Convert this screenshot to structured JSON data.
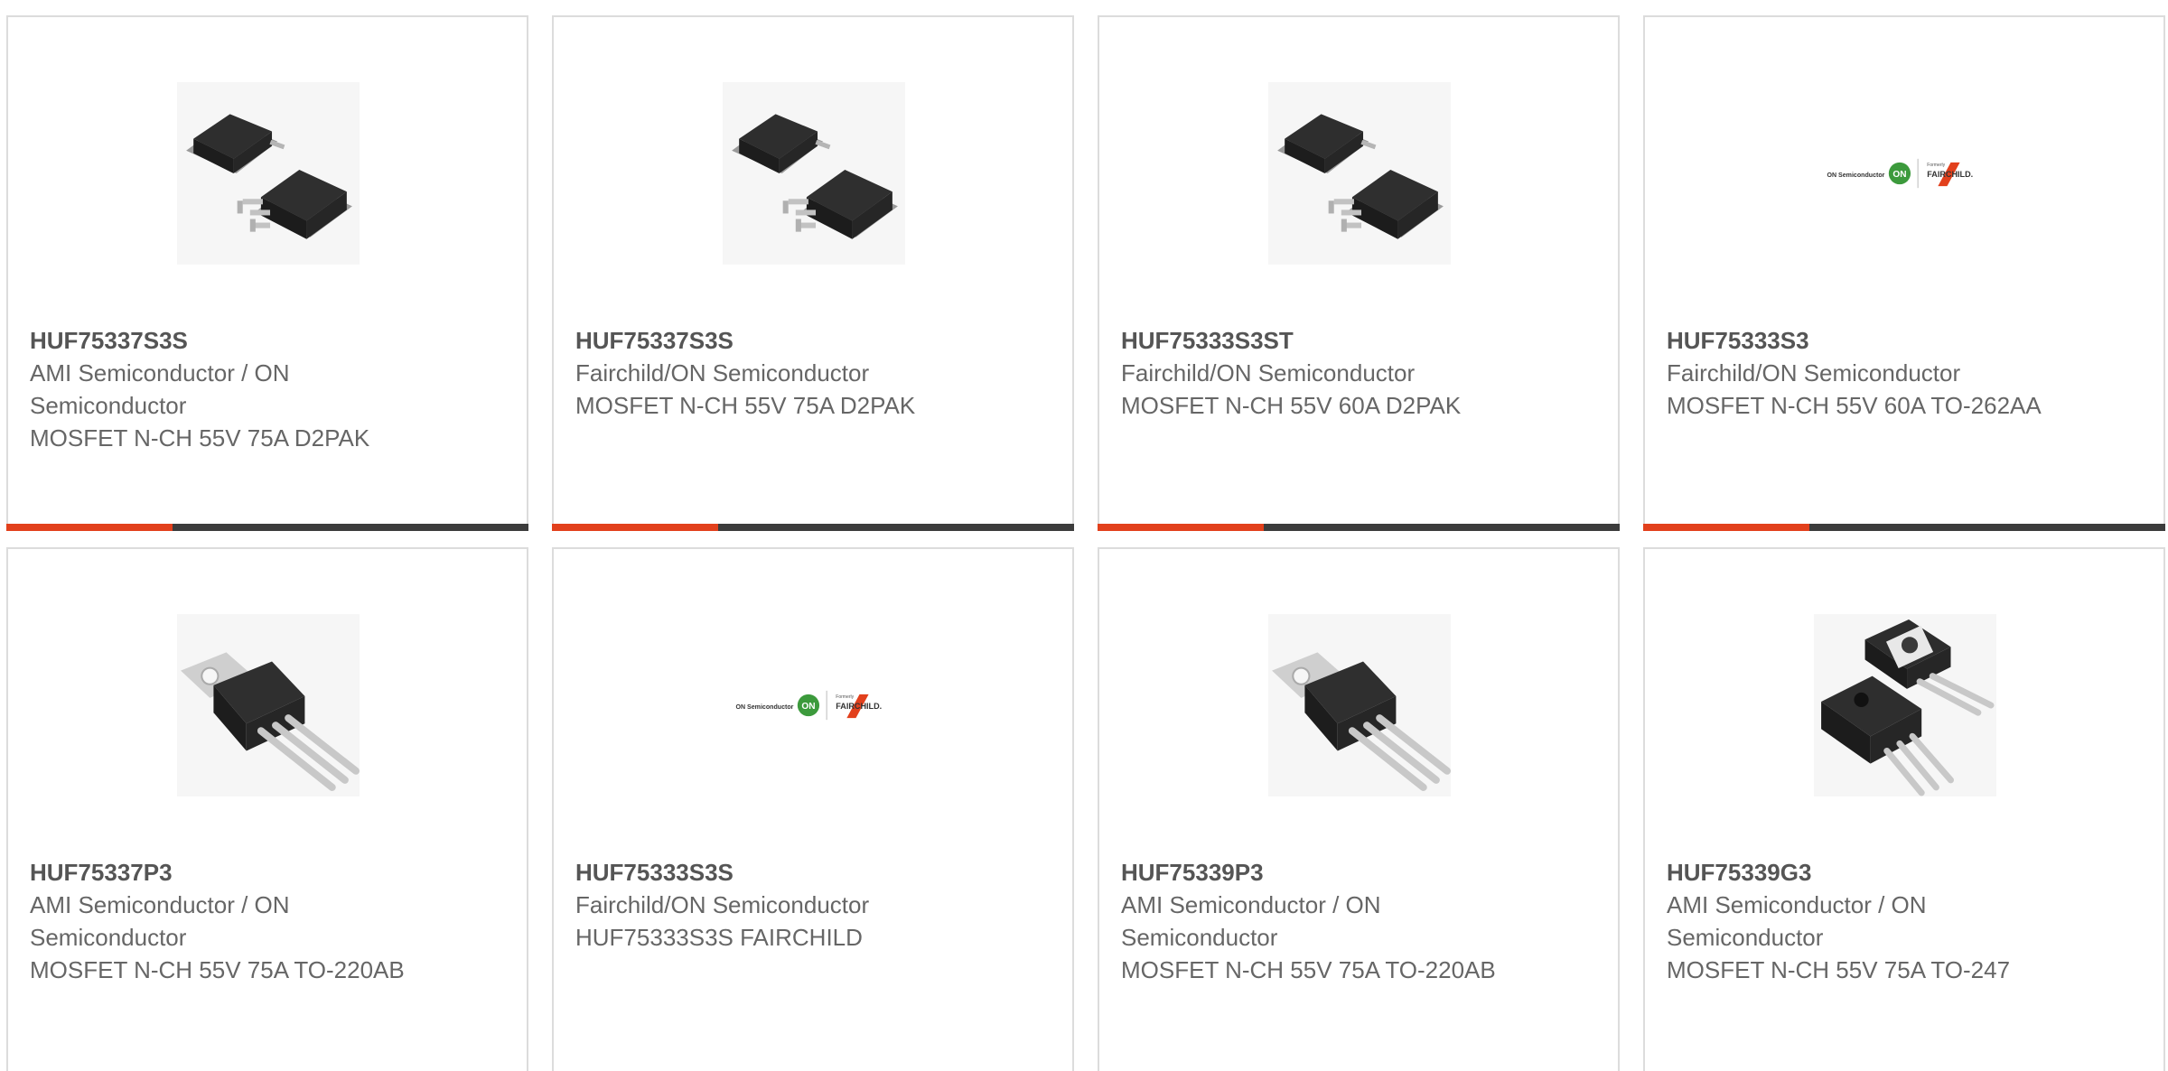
{
  "products": [
    {
      "part_number": "HUF75337S3S",
      "manufacturer": "AMI Semiconductor / ON Semiconductor",
      "description": "MOSFET N-CH 55V 75A D2PAK",
      "image": "d2pak-package-image"
    },
    {
      "part_number": "HUF75337S3S",
      "manufacturer": "Fairchild/ON Semiconductor",
      "description": "MOSFET N-CH 55V 75A D2PAK",
      "image": "d2pak-package-image"
    },
    {
      "part_number": "HUF75333S3ST",
      "manufacturer": "Fairchild/ON Semiconductor",
      "description": "MOSFET N-CH 55V 60A D2PAK",
      "image": "d2pak-package-image"
    },
    {
      "part_number": "HUF75333S3",
      "manufacturer": "Fairchild/ON Semiconductor",
      "description": "MOSFET N-CH 55V 60A TO-262AA",
      "image": "on-semi-fairchild-logo"
    },
    {
      "part_number": "HUF75337P3",
      "manufacturer": "AMI Semiconductor / ON Semiconductor",
      "description": "MOSFET N-CH 55V 75A TO-220AB",
      "image": "to220-package-image"
    },
    {
      "part_number": "HUF75333S3S",
      "manufacturer": "Fairchild/ON Semiconductor",
      "description": "HUF75333S3S FAIRCHILD",
      "image": "on-semi-fairchild-logo"
    },
    {
      "part_number": "HUF75339P3",
      "manufacturer": "AMI Semiconductor / ON Semiconductor",
      "description": "MOSFET N-CH 55V 75A TO-220AB",
      "image": "to220-package-image"
    },
    {
      "part_number": "HUF75339G3",
      "manufacturer": "AMI Semiconductor / ON Semiconductor",
      "description": "MOSFET N-CH 55V 75A TO-247",
      "image": "to247-package-image"
    }
  ],
  "logo_text": {
    "on_semi": "ON Semiconductor",
    "on_badge": "ON",
    "formerly": "Formerly",
    "fairchild": "FAIRCHILD."
  },
  "colors": {
    "accent": "#e2401c",
    "bar": "#3c3c3c",
    "border": "#dcdcdc",
    "text": "#666666",
    "on_green": "#3c9a3c",
    "fairchild_red": "#e2401c"
  }
}
